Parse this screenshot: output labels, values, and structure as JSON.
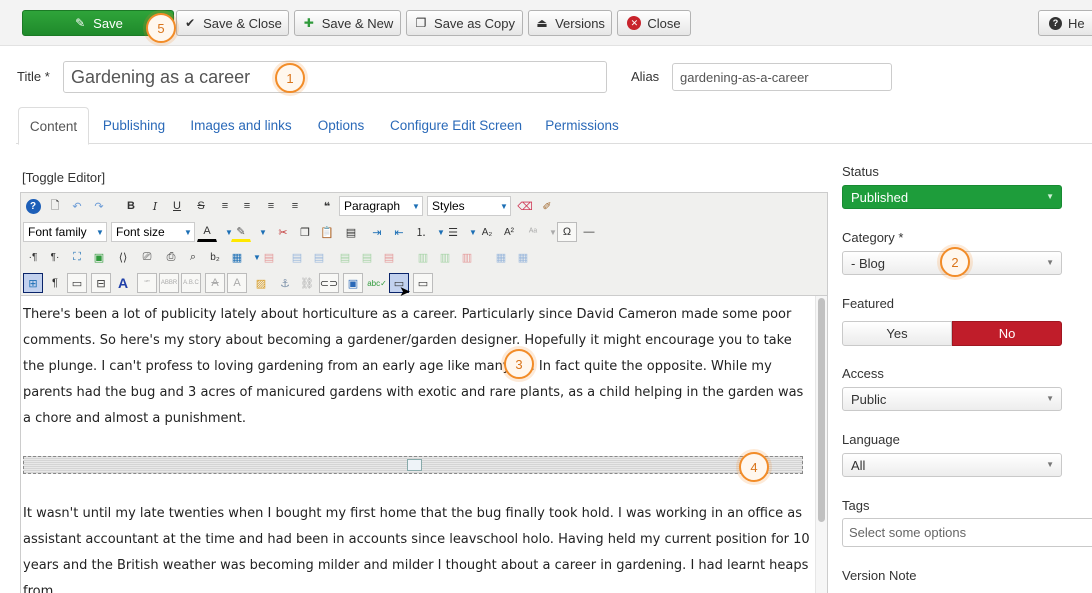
{
  "toolbar": {
    "save": "Save",
    "save_close": "Save & Close",
    "save_new": "Save & New",
    "save_copy": "Save as Copy",
    "versions": "Versions",
    "close": "Close",
    "help": "He"
  },
  "callouts": [
    "1",
    "2",
    "3",
    "4",
    "5"
  ],
  "title": {
    "label": "Title *",
    "value": "Gardening as a career"
  },
  "alias": {
    "label": "Alias",
    "value": "gardening-as-a-career"
  },
  "tabs": [
    "Content",
    "Publishing",
    "Images and links",
    "Options",
    "Configure Edit Screen",
    "Permissions"
  ],
  "editor": {
    "toggle": "[Toggle Editor]",
    "format": "Paragraph",
    "styles": "Styles",
    "font_family": "Font family",
    "font_size": "Font size",
    "paragraph1": "There's been a lot of publicity lately about horticulture as a career.  Particularly since David Cameron made some poor comments. So here's my story about becoming a gardener/garden designer.  Hopefully it might encourage you to take the plunge.  I can't profess to loving gardening from an early age like many do.  In fact quite the opposite.  While my parents had the bug and 3 acres of manicured gardens with exotic and rare plants, as a child helping in the garden was a chore and almost a punishment.",
    "paragraph2": " It wasn't until my late twenties when I bought my first home that the bug finally took hold.  I was working in an office as assistant accountant at the time and had been in accounts since leavschool holo.  Having held my current position for 10 years and the British weather was becoming milder and milder I thought about a career in gardening.  I had learnt heaps from"
  },
  "sidebar": {
    "status_label": "Status",
    "status_value": "Published",
    "category_label": "Category *",
    "category_value": "- Blog",
    "featured_label": "Featured",
    "featured_yes": "Yes",
    "featured_no": "No",
    "access_label": "Access",
    "access_value": "Public",
    "language_label": "Language",
    "language_value": "All",
    "tags_label": "Tags",
    "tags_placeholder": "Select some options",
    "version_note_label": "Version Note"
  },
  "colors": {
    "save_green": "#239c31",
    "published_green": "#1e9d3b",
    "no_red": "#c01d2a",
    "link_blue": "#2a69b8",
    "callout_orange": "#f28c28"
  }
}
